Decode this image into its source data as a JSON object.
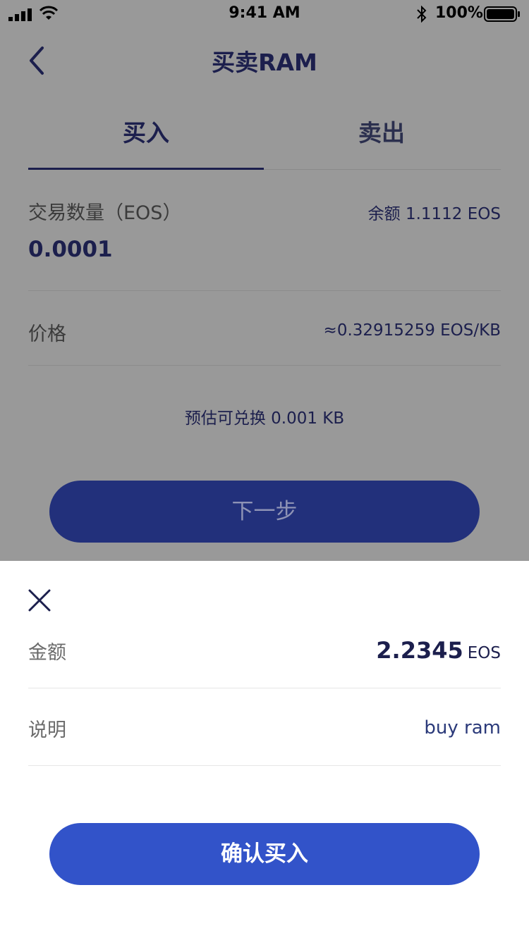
{
  "status_bar": {
    "time": "9:41 AM",
    "battery_percent": "100%"
  },
  "nav": {
    "title": "买卖RAM",
    "back_icon": "chevron-left-icon"
  },
  "tabs": [
    {
      "label": "买入",
      "active": true
    },
    {
      "label": "卖出",
      "active": false
    }
  ],
  "trade": {
    "quantity_label": "交易数量（EOS）",
    "balance": "余额 1.1112 EOS",
    "quantity_value": "0.0001",
    "price_label": "价格",
    "price_value": "≈0.32915259 EOS/KB",
    "estimate": "预估可兑换 0.001 KB",
    "next_label": "下一步"
  },
  "sheet": {
    "close_icon": "close-icon",
    "amount_label": "金额",
    "amount_value": "2.2345",
    "amount_unit": "EOS",
    "memo_label": "说明",
    "memo_value": "buy ram",
    "confirm_label": "确认买入"
  },
  "colors": {
    "primary": "#3253c9",
    "dark_primary": "#22307b",
    "text_dark": "#1c1f4d",
    "overlay": "#999999"
  }
}
